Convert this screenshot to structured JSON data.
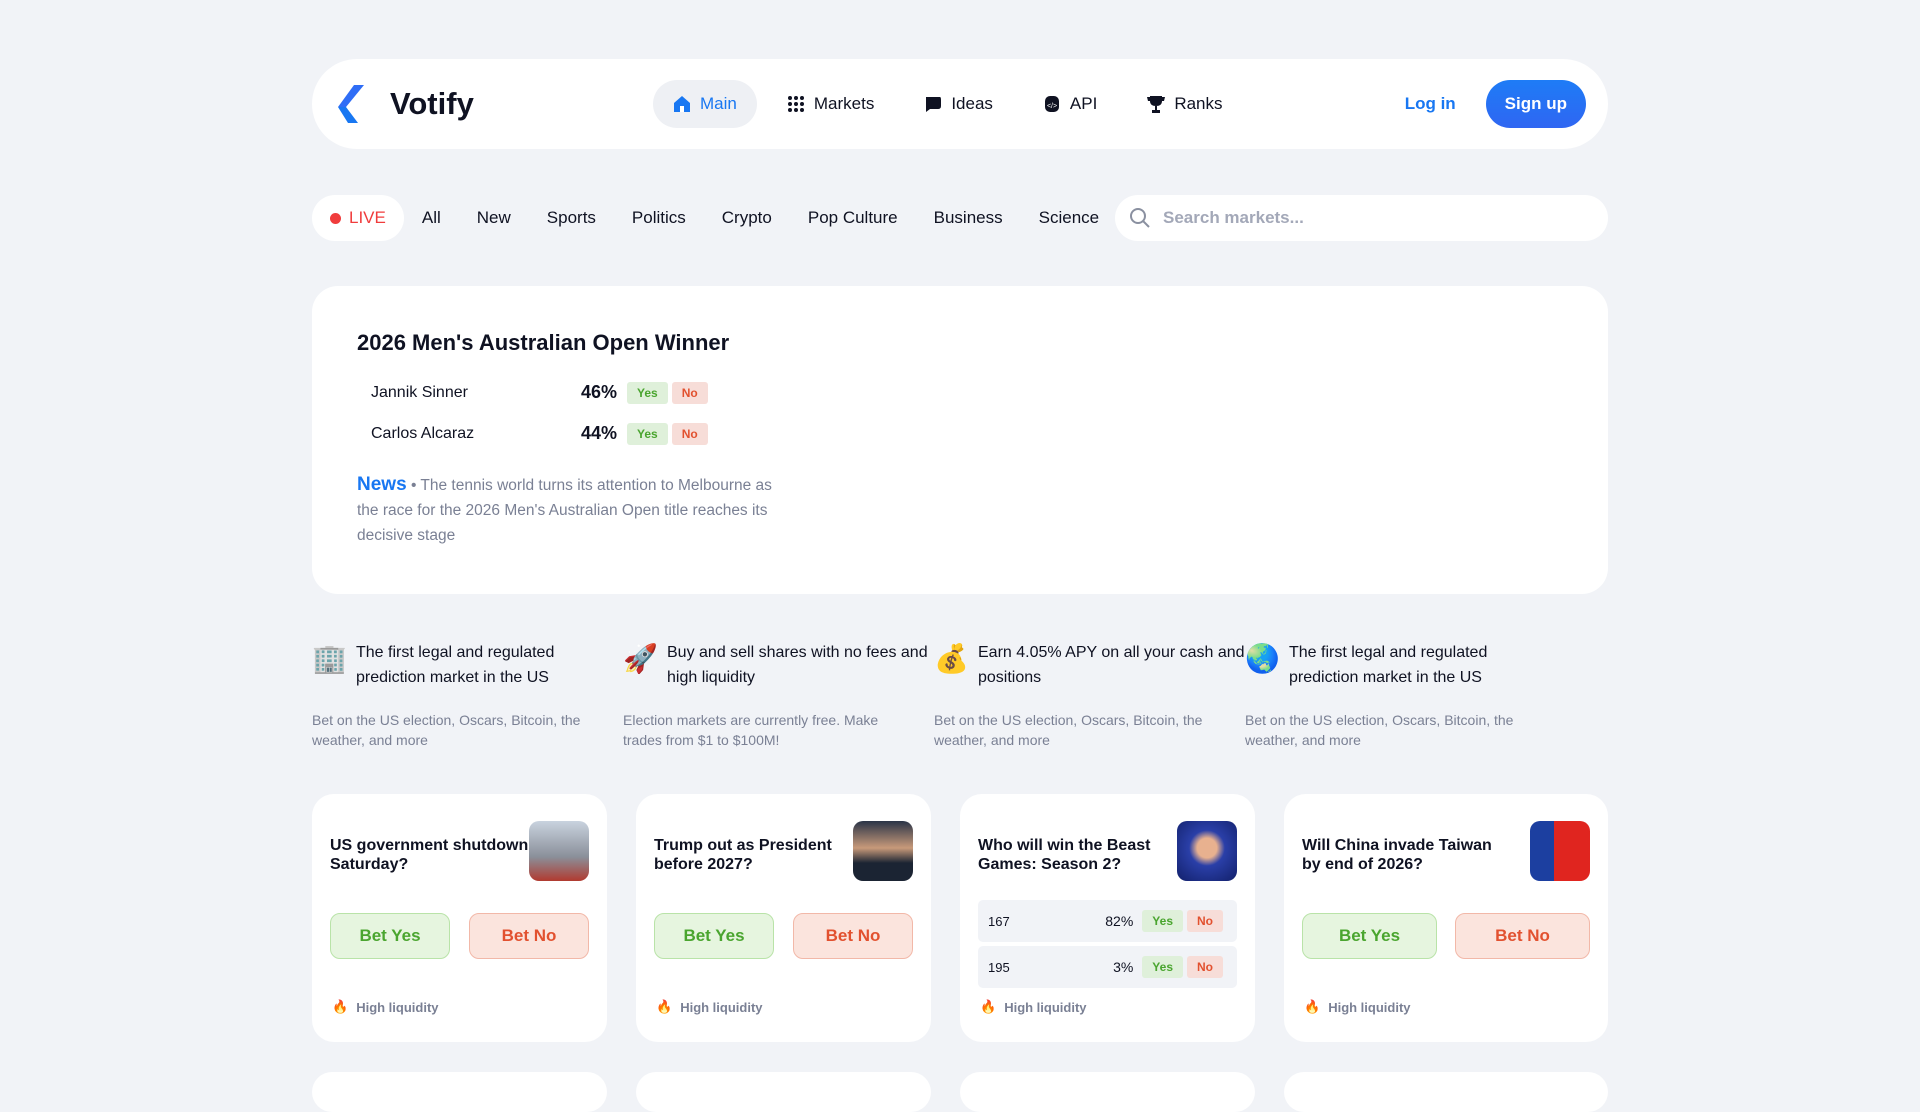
{
  "header": {
    "brand": "Votify",
    "nav": [
      {
        "label": "Main",
        "icon": "home-icon"
      },
      {
        "label": "Markets",
        "icon": "grid-icon"
      },
      {
        "label": "Ideas",
        "icon": "chat-icon"
      },
      {
        "label": "API",
        "icon": "api-icon"
      },
      {
        "label": "Ranks",
        "icon": "trophy-icon"
      }
    ],
    "login": "Log in",
    "signup": "Sign up"
  },
  "filters": {
    "live": "LIVE",
    "items": [
      "All",
      "New",
      "Sports",
      "Politics",
      "Crypto",
      "Pop Culture",
      "Business",
      "Science"
    ],
    "search_placeholder": "Search markets..."
  },
  "hero": {
    "title": "2026 Men's Australian Open Winner",
    "outcomes": [
      {
        "name": "Jannik Sinner",
        "pct": "46%"
      },
      {
        "name": "Carlos Alcaraz",
        "pct": "44%"
      }
    ],
    "yes": "Yes",
    "no": "No",
    "news_label": "News",
    "news_text": "• The tennis world turns its attention to Melbourne as the race for the 2026 Men's Australian Open title reaches its decisive stage"
  },
  "features": [
    {
      "icon": "building-icon",
      "title": "The first legal and regulated prediction market in the US",
      "sub": "Bet on the US election, Oscars, Bitcoin, the weather, and more"
    },
    {
      "icon": "rocket-icon",
      "title": "Buy and sell shares with no fees and high liquidity",
      "sub": "Election markets are currently free. Make trades from $1 to $100M!"
    },
    {
      "icon": "money-bag-icon",
      "title": "Earn 4.05% APY on all your cash and positions",
      "sub": "Bet on the US election, Oscars, Bitcoin, the weather, and more"
    },
    {
      "icon": "globe-icon",
      "title": "The first legal and regulated prediction market in the US",
      "sub": "Bet on the US election, Oscars, Bitcoin, the weather, and more"
    }
  ],
  "cards": [
    {
      "title": "US government shutdown Saturday?",
      "bet_yes": "Bet Yes",
      "bet_no": "Bet No",
      "liquidity": "High liquidity"
    },
    {
      "title": "Trump out as President before 2027?",
      "bet_yes": "Bet Yes",
      "bet_no": "Bet No",
      "liquidity": "High liquidity"
    },
    {
      "title": "Who will win the Beast Games: Season 2?",
      "outcomes": [
        {
          "name": "167",
          "pct": "82%"
        },
        {
          "name": "195",
          "pct": "3%"
        }
      ],
      "yes": "Yes",
      "no": "No",
      "liquidity": "High liquidity"
    },
    {
      "title": "Will China invade Taiwan by end of 2026?",
      "bet_yes": "Bet Yes",
      "bet_no": "Bet No",
      "liquidity": "High liquidity"
    }
  ],
  "colors": {
    "accent": "#1877f2",
    "live": "#f03c3c",
    "yes": "#4aa52f",
    "no": "#e2512f"
  }
}
